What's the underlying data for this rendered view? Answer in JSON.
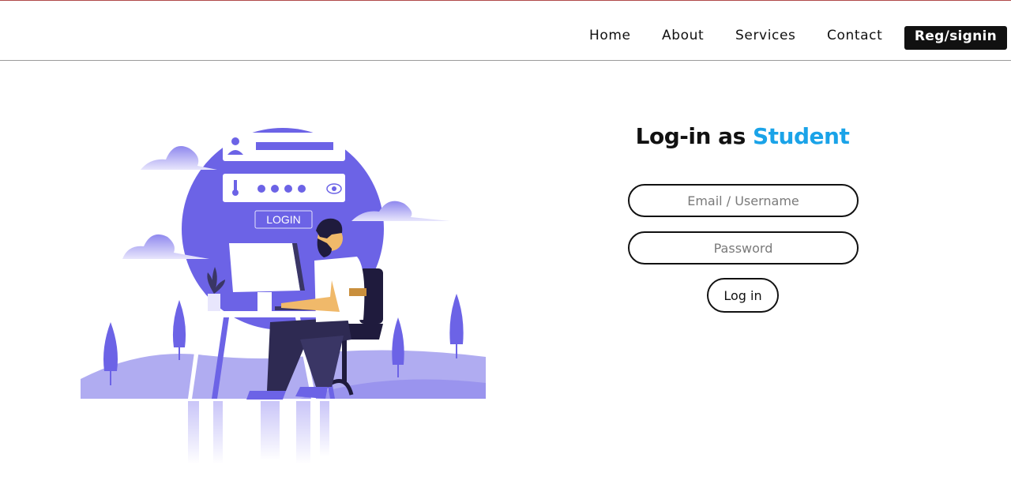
{
  "nav": {
    "home": "Home",
    "about": "About",
    "services": "Services",
    "contact": "Contact",
    "register": "Reg/signin"
  },
  "illustration": {
    "login_label": "LOGIN"
  },
  "form": {
    "title_prefix": "Log-in as ",
    "title_accent": "Student",
    "email_placeholder": "Email / Username",
    "password_placeholder": "Password",
    "submit_label": "Log in"
  },
  "colors": {
    "accent": "#1aa3e8",
    "illustration_primary": "#6c63e6",
    "illustration_light": "#b9b4f5",
    "nav_button_bg": "#111111"
  }
}
